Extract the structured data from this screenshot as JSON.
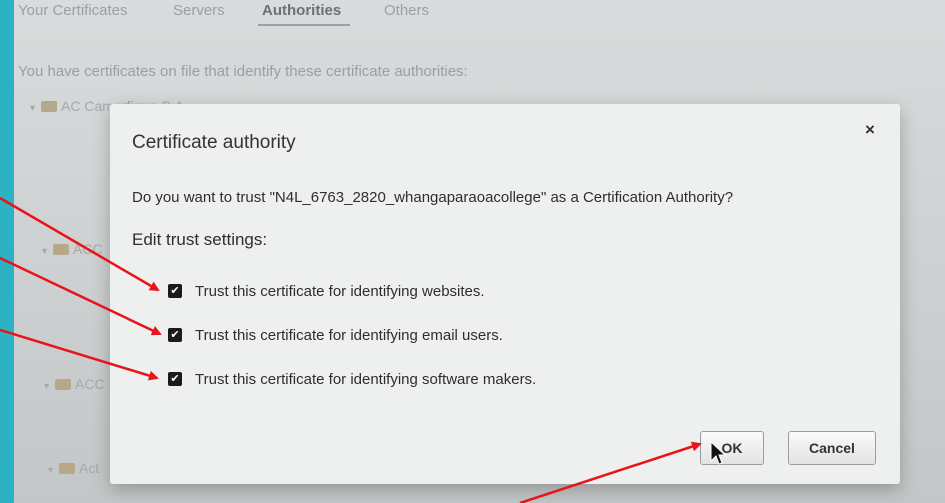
{
  "tabs": [
    {
      "label": "Your Certificates"
    },
    {
      "label": "Servers"
    },
    {
      "label": "Authorities"
    },
    {
      "label": "Others"
    }
  ],
  "intro": "You have certificates on file that identify these certificate authorities:",
  "tree": [
    {
      "label": "AC Camerfirma S.A."
    },
    {
      "label": "ACC"
    },
    {
      "label": "ACC"
    },
    {
      "label": "Act"
    }
  ],
  "dialog": {
    "title": "Certificate authority",
    "close": "×",
    "question": "Do you want to trust \"N4L_6763_2820_whangaparaoacollege\" as a Certification Authority?",
    "edit_label": "Edit trust settings:",
    "options": [
      {
        "label": "Trust this certificate for identifying websites.",
        "checked": true
      },
      {
        "label": "Trust this certificate for identifying email users.",
        "checked": true
      },
      {
        "label": "Trust this certificate for identifying software makers.",
        "checked": true
      }
    ],
    "ok_label": "OK",
    "cancel_label": "Cancel"
  },
  "colors": {
    "border": "#2bb3c4",
    "annotation_arrow": "#e8141a",
    "checkbox": "#1a1a1a"
  }
}
